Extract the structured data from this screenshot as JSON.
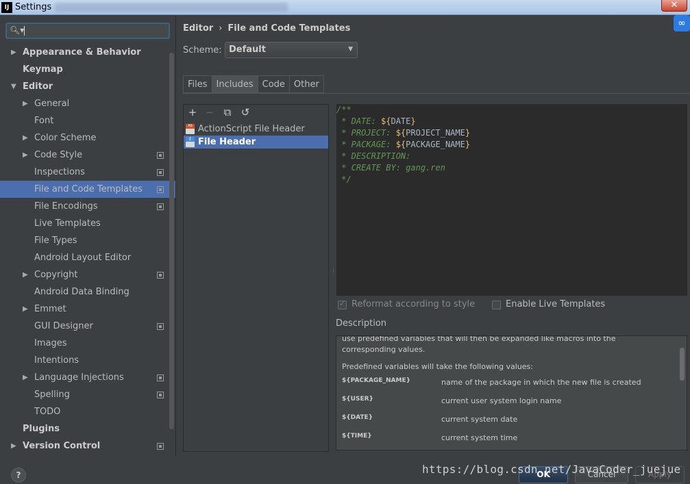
{
  "window": {
    "title": "Settings",
    "close_glyph": "✕"
  },
  "search": {
    "placeholder": "",
    "value": ""
  },
  "tree": [
    {
      "label": "Appearance & Behavior",
      "level": 0,
      "arrow": "▶",
      "bold": true
    },
    {
      "label": "Keymap",
      "level": 0,
      "bold": true
    },
    {
      "label": "Editor",
      "level": 0,
      "arrow": "▼",
      "bold": true
    },
    {
      "label": "General",
      "level": 1,
      "arrow": "▶"
    },
    {
      "label": "Font",
      "level": 1
    },
    {
      "label": "Color Scheme",
      "level": 1,
      "arrow": "▶"
    },
    {
      "label": "Code Style",
      "level": 1,
      "arrow": "▶",
      "proj": true
    },
    {
      "label": "Inspections",
      "level": 1,
      "proj": true
    },
    {
      "label": "File and Code Templates",
      "level": 1,
      "proj": true,
      "selected": true
    },
    {
      "label": "File Encodings",
      "level": 1,
      "proj": true
    },
    {
      "label": "Live Templates",
      "level": 1
    },
    {
      "label": "File Types",
      "level": 1
    },
    {
      "label": "Android Layout Editor",
      "level": 1
    },
    {
      "label": "Copyright",
      "level": 1,
      "arrow": "▶",
      "proj": true
    },
    {
      "label": "Android Data Binding",
      "level": 1
    },
    {
      "label": "Emmet",
      "level": 1,
      "arrow": "▶"
    },
    {
      "label": "GUI Designer",
      "level": 1,
      "proj": true
    },
    {
      "label": "Images",
      "level": 1
    },
    {
      "label": "Intentions",
      "level": 1
    },
    {
      "label": "Language Injections",
      "level": 1,
      "arrow": "▶",
      "proj": true
    },
    {
      "label": "Spelling",
      "level": 1,
      "proj": true
    },
    {
      "label": "TODO",
      "level": 1
    },
    {
      "label": "Plugins",
      "level": 0,
      "bold": true
    },
    {
      "label": "Version Control",
      "level": 0,
      "arrow": "▶",
      "bold": true,
      "proj": true
    }
  ],
  "breadcrumb": {
    "root": "Editor",
    "sep": "›",
    "current": "File and Code Templates"
  },
  "scheme": {
    "label": "Scheme:",
    "value": "Default"
  },
  "tabs": [
    {
      "label": "Files",
      "active": false
    },
    {
      "label": "Includes",
      "active": true
    },
    {
      "label": "Code",
      "active": false
    },
    {
      "label": "Other",
      "active": false
    }
  ],
  "toolbar": {
    "add": "+",
    "remove": "−",
    "copy": "⧉",
    "reset": "↺"
  },
  "templates": [
    {
      "name": "ActionScript File Header",
      "badge": "AS",
      "badge_color": "#c8552e",
      "selected": false
    },
    {
      "name": "File Header",
      "badge": "J",
      "badge_color": "#4b8ad6",
      "selected": true
    }
  ],
  "code_lines": [
    [
      {
        "t": "/**",
        "c": "comment"
      }
    ],
    [
      {
        "t": " * DATE: ",
        "c": "comment"
      },
      {
        "t": "${",
        "c": "var"
      },
      {
        "t": "DATE",
        "c": "plain"
      },
      {
        "t": "}",
        "c": "var"
      }
    ],
    [
      {
        "t": " * PROJECT: ",
        "c": "comment"
      },
      {
        "t": "${",
        "c": "var"
      },
      {
        "t": "PROJECT_NAME",
        "c": "plain"
      },
      {
        "t": "}",
        "c": "var"
      }
    ],
    [
      {
        "t": " * PACKAGE: ",
        "c": "comment"
      },
      {
        "t": "${",
        "c": "var"
      },
      {
        "t": "PACKAGE_NAME",
        "c": "plain"
      },
      {
        "t": "}",
        "c": "var"
      }
    ],
    [
      {
        "t": " * DESCRIPTION:",
        "c": "comment"
      }
    ],
    [
      {
        "t": " * CREATE BY: gang.ren",
        "c": "comment"
      }
    ],
    [
      {
        "t": " */",
        "c": "comment"
      }
    ]
  ],
  "options": {
    "reformat_label": "Reformat according to style",
    "reformat_checked": true,
    "live_label": "Enable Live Templates",
    "live_checked": false
  },
  "description": {
    "title": "Description",
    "intro": "use predefined variables that will then be expanded like macros into the corresponding values.",
    "predef": "Predefined variables will take the following values:",
    "vars": [
      {
        "name": "${PACKAGE_NAME}",
        "desc": "name of the package in which the new file is created"
      },
      {
        "name": "${USER}",
        "desc": "current user system login name"
      },
      {
        "name": "${DATE}",
        "desc": "current system date"
      },
      {
        "name": "${TIME}",
        "desc": "current system time"
      }
    ]
  },
  "buttons": {
    "help": "?",
    "ok": "OK",
    "cancel": "Cancel",
    "apply": "Apply"
  },
  "watermark": "https://blog.csdn.net/JavaCoder_juejue"
}
